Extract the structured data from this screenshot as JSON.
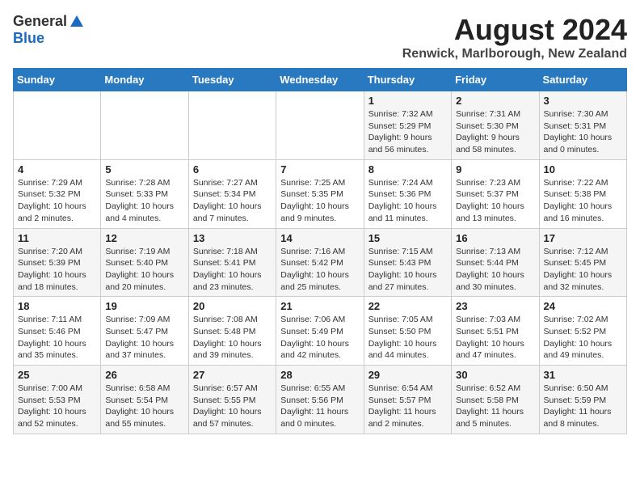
{
  "header": {
    "logo_general": "General",
    "logo_blue": "Blue",
    "month_title": "August 2024",
    "location": "Renwick, Marlborough, New Zealand"
  },
  "days_of_week": [
    "Sunday",
    "Monday",
    "Tuesday",
    "Wednesday",
    "Thursday",
    "Friday",
    "Saturday"
  ],
  "weeks": [
    [
      {
        "day": "",
        "info": ""
      },
      {
        "day": "",
        "info": ""
      },
      {
        "day": "",
        "info": ""
      },
      {
        "day": "",
        "info": ""
      },
      {
        "day": "1",
        "info": "Sunrise: 7:32 AM\nSunset: 5:29 PM\nDaylight: 9 hours\nand 56 minutes."
      },
      {
        "day": "2",
        "info": "Sunrise: 7:31 AM\nSunset: 5:30 PM\nDaylight: 9 hours\nand 58 minutes."
      },
      {
        "day": "3",
        "info": "Sunrise: 7:30 AM\nSunset: 5:31 PM\nDaylight: 10 hours\nand 0 minutes."
      }
    ],
    [
      {
        "day": "4",
        "info": "Sunrise: 7:29 AM\nSunset: 5:32 PM\nDaylight: 10 hours\nand 2 minutes."
      },
      {
        "day": "5",
        "info": "Sunrise: 7:28 AM\nSunset: 5:33 PM\nDaylight: 10 hours\nand 4 minutes."
      },
      {
        "day": "6",
        "info": "Sunrise: 7:27 AM\nSunset: 5:34 PM\nDaylight: 10 hours\nand 7 minutes."
      },
      {
        "day": "7",
        "info": "Sunrise: 7:25 AM\nSunset: 5:35 PM\nDaylight: 10 hours\nand 9 minutes."
      },
      {
        "day": "8",
        "info": "Sunrise: 7:24 AM\nSunset: 5:36 PM\nDaylight: 10 hours\nand 11 minutes."
      },
      {
        "day": "9",
        "info": "Sunrise: 7:23 AM\nSunset: 5:37 PM\nDaylight: 10 hours\nand 13 minutes."
      },
      {
        "day": "10",
        "info": "Sunrise: 7:22 AM\nSunset: 5:38 PM\nDaylight: 10 hours\nand 16 minutes."
      }
    ],
    [
      {
        "day": "11",
        "info": "Sunrise: 7:20 AM\nSunset: 5:39 PM\nDaylight: 10 hours\nand 18 minutes."
      },
      {
        "day": "12",
        "info": "Sunrise: 7:19 AM\nSunset: 5:40 PM\nDaylight: 10 hours\nand 20 minutes."
      },
      {
        "day": "13",
        "info": "Sunrise: 7:18 AM\nSunset: 5:41 PM\nDaylight: 10 hours\nand 23 minutes."
      },
      {
        "day": "14",
        "info": "Sunrise: 7:16 AM\nSunset: 5:42 PM\nDaylight: 10 hours\nand 25 minutes."
      },
      {
        "day": "15",
        "info": "Sunrise: 7:15 AM\nSunset: 5:43 PM\nDaylight: 10 hours\nand 27 minutes."
      },
      {
        "day": "16",
        "info": "Sunrise: 7:13 AM\nSunset: 5:44 PM\nDaylight: 10 hours\nand 30 minutes."
      },
      {
        "day": "17",
        "info": "Sunrise: 7:12 AM\nSunset: 5:45 PM\nDaylight: 10 hours\nand 32 minutes."
      }
    ],
    [
      {
        "day": "18",
        "info": "Sunrise: 7:11 AM\nSunset: 5:46 PM\nDaylight: 10 hours\nand 35 minutes."
      },
      {
        "day": "19",
        "info": "Sunrise: 7:09 AM\nSunset: 5:47 PM\nDaylight: 10 hours\nand 37 minutes."
      },
      {
        "day": "20",
        "info": "Sunrise: 7:08 AM\nSunset: 5:48 PM\nDaylight: 10 hours\nand 39 minutes."
      },
      {
        "day": "21",
        "info": "Sunrise: 7:06 AM\nSunset: 5:49 PM\nDaylight: 10 hours\nand 42 minutes."
      },
      {
        "day": "22",
        "info": "Sunrise: 7:05 AM\nSunset: 5:50 PM\nDaylight: 10 hours\nand 44 minutes."
      },
      {
        "day": "23",
        "info": "Sunrise: 7:03 AM\nSunset: 5:51 PM\nDaylight: 10 hours\nand 47 minutes."
      },
      {
        "day": "24",
        "info": "Sunrise: 7:02 AM\nSunset: 5:52 PM\nDaylight: 10 hours\nand 49 minutes."
      }
    ],
    [
      {
        "day": "25",
        "info": "Sunrise: 7:00 AM\nSunset: 5:53 PM\nDaylight: 10 hours\nand 52 minutes."
      },
      {
        "day": "26",
        "info": "Sunrise: 6:58 AM\nSunset: 5:54 PM\nDaylight: 10 hours\nand 55 minutes."
      },
      {
        "day": "27",
        "info": "Sunrise: 6:57 AM\nSunset: 5:55 PM\nDaylight: 10 hours\nand 57 minutes."
      },
      {
        "day": "28",
        "info": "Sunrise: 6:55 AM\nSunset: 5:56 PM\nDaylight: 11 hours\nand 0 minutes."
      },
      {
        "day": "29",
        "info": "Sunrise: 6:54 AM\nSunset: 5:57 PM\nDaylight: 11 hours\nand 2 minutes."
      },
      {
        "day": "30",
        "info": "Sunrise: 6:52 AM\nSunset: 5:58 PM\nDaylight: 11 hours\nand 5 minutes."
      },
      {
        "day": "31",
        "info": "Sunrise: 6:50 AM\nSunset: 5:59 PM\nDaylight: 11 hours\nand 8 minutes."
      }
    ]
  ]
}
